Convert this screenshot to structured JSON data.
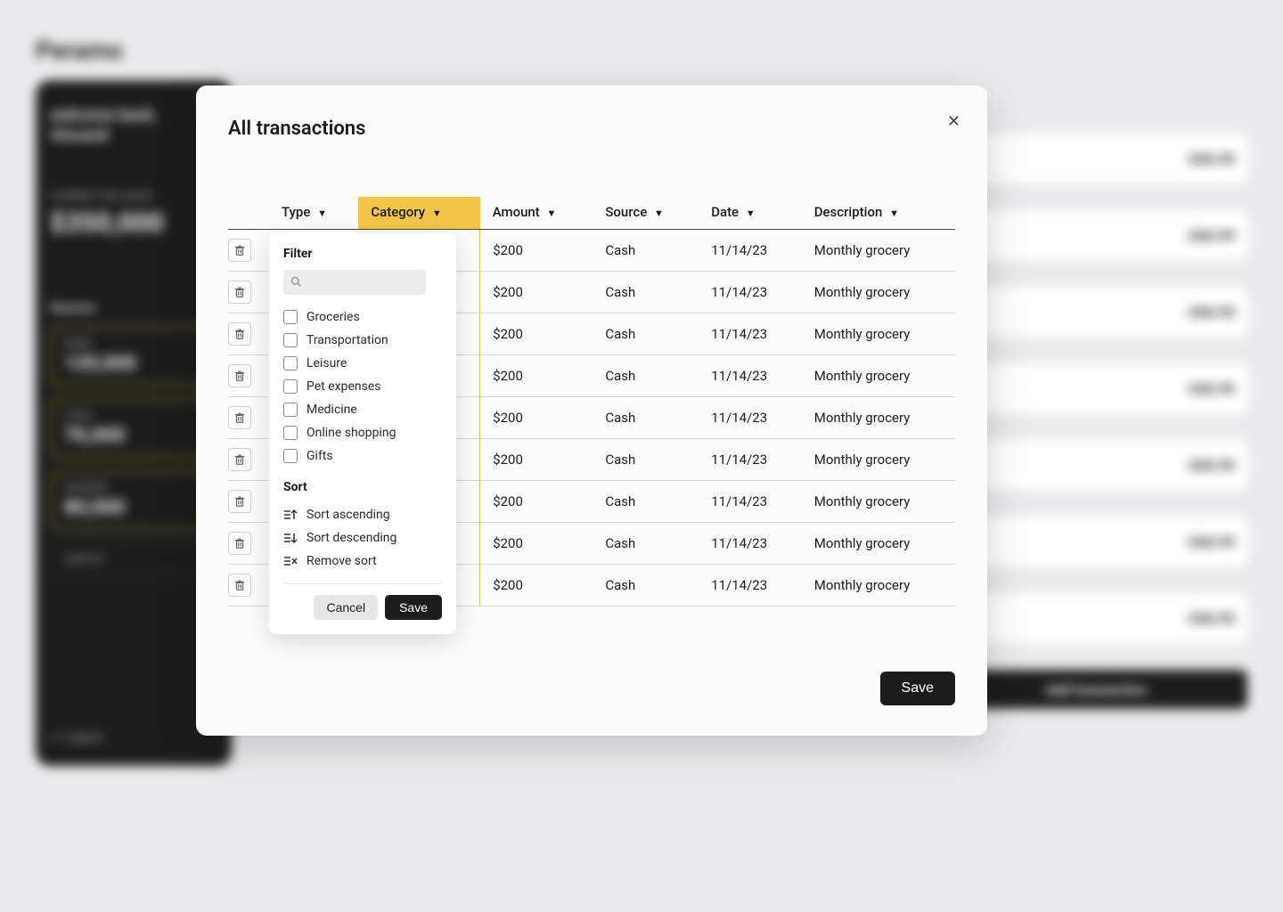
{
  "brand": "Peramo",
  "sidebar": {
    "welcome_line1": "welcome back,",
    "welcome_line2": "Vincent!",
    "balance_label": "CURRENT BALANCE",
    "balance_amount": "$350,000",
    "sources_label": "Sources",
    "sources": [
      {
        "name": "BANK",
        "amount": "120,000"
      },
      {
        "name": "CASH",
        "amount": "70,000"
      },
      {
        "name": "SAVINGS",
        "amount": "80,000"
      },
      {
        "name": "CRYPTO",
        "amount": ""
      }
    ],
    "logout": "Logout"
  },
  "bg_txn_amount": "-$40.99",
  "bg_add_label": "Add transaction",
  "modal": {
    "title": "All transactions",
    "close": "✕",
    "columns": {
      "type": "Type",
      "category": "Category",
      "amount": "Amount",
      "source": "Source",
      "date": "Date",
      "description": "Description"
    },
    "rows": [
      {
        "amount": "$200",
        "source": "Cash",
        "date": "11/14/23",
        "desc": "Monthly grocery"
      },
      {
        "amount": "$200",
        "source": "Cash",
        "date": "11/14/23",
        "desc": "Monthly grocery"
      },
      {
        "amount": "$200",
        "source": "Cash",
        "date": "11/14/23",
        "desc": "Monthly grocery"
      },
      {
        "amount": "$200",
        "source": "Cash",
        "date": "11/14/23",
        "desc": "Monthly grocery"
      },
      {
        "amount": "$200",
        "source": "Cash",
        "date": "11/14/23",
        "desc": "Monthly grocery"
      },
      {
        "amount": "$200",
        "source": "Cash",
        "date": "11/14/23",
        "desc": "Monthly grocery"
      },
      {
        "amount": "$200",
        "source": "Cash",
        "date": "11/14/23",
        "desc": "Monthly grocery"
      },
      {
        "amount": "$200",
        "source": "Cash",
        "date": "11/14/23",
        "desc": "Monthly grocery"
      },
      {
        "amount": "$200",
        "source": "Cash",
        "date": "11/14/23",
        "desc": "Monthly grocery"
      }
    ],
    "save": "Save"
  },
  "dropdown": {
    "filter_heading": "Filter",
    "search_placeholder": "",
    "options": [
      "Groceries",
      "Transportation",
      "Leisure",
      "Pet expenses",
      "Medicine",
      "Online shopping",
      "Gifts"
    ],
    "sort_heading": "Sort",
    "sort_asc": "Sort ascending",
    "sort_desc": "Sort descending",
    "sort_remove": "Remove sort",
    "cancel": "Cancel",
    "save": "Save"
  },
  "colors": {
    "accent": "#f3c64b",
    "dark": "#1c1c1c"
  }
}
